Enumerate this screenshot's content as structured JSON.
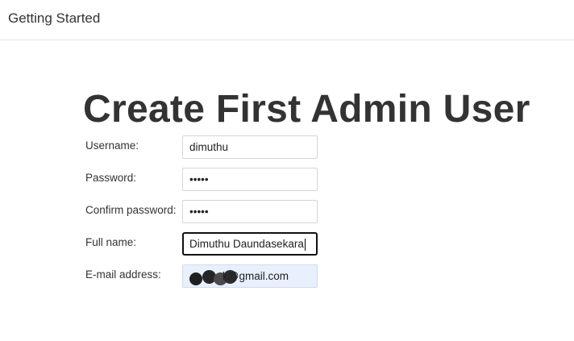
{
  "header": {
    "title": "Getting Started"
  },
  "page": {
    "title": "Create First Admin User"
  },
  "form": {
    "username": {
      "label": "Username:",
      "value": "dimuthu"
    },
    "password": {
      "label": "Password:",
      "value": "•••••"
    },
    "confirm_password": {
      "label": "Confirm password:",
      "value": "•••••"
    },
    "full_name": {
      "label": "Full name:",
      "value": "Dimuthu Daundasekara"
    },
    "email": {
      "label": "E-mail address:",
      "value_visible_suffix": "k@gmail.com"
    }
  }
}
